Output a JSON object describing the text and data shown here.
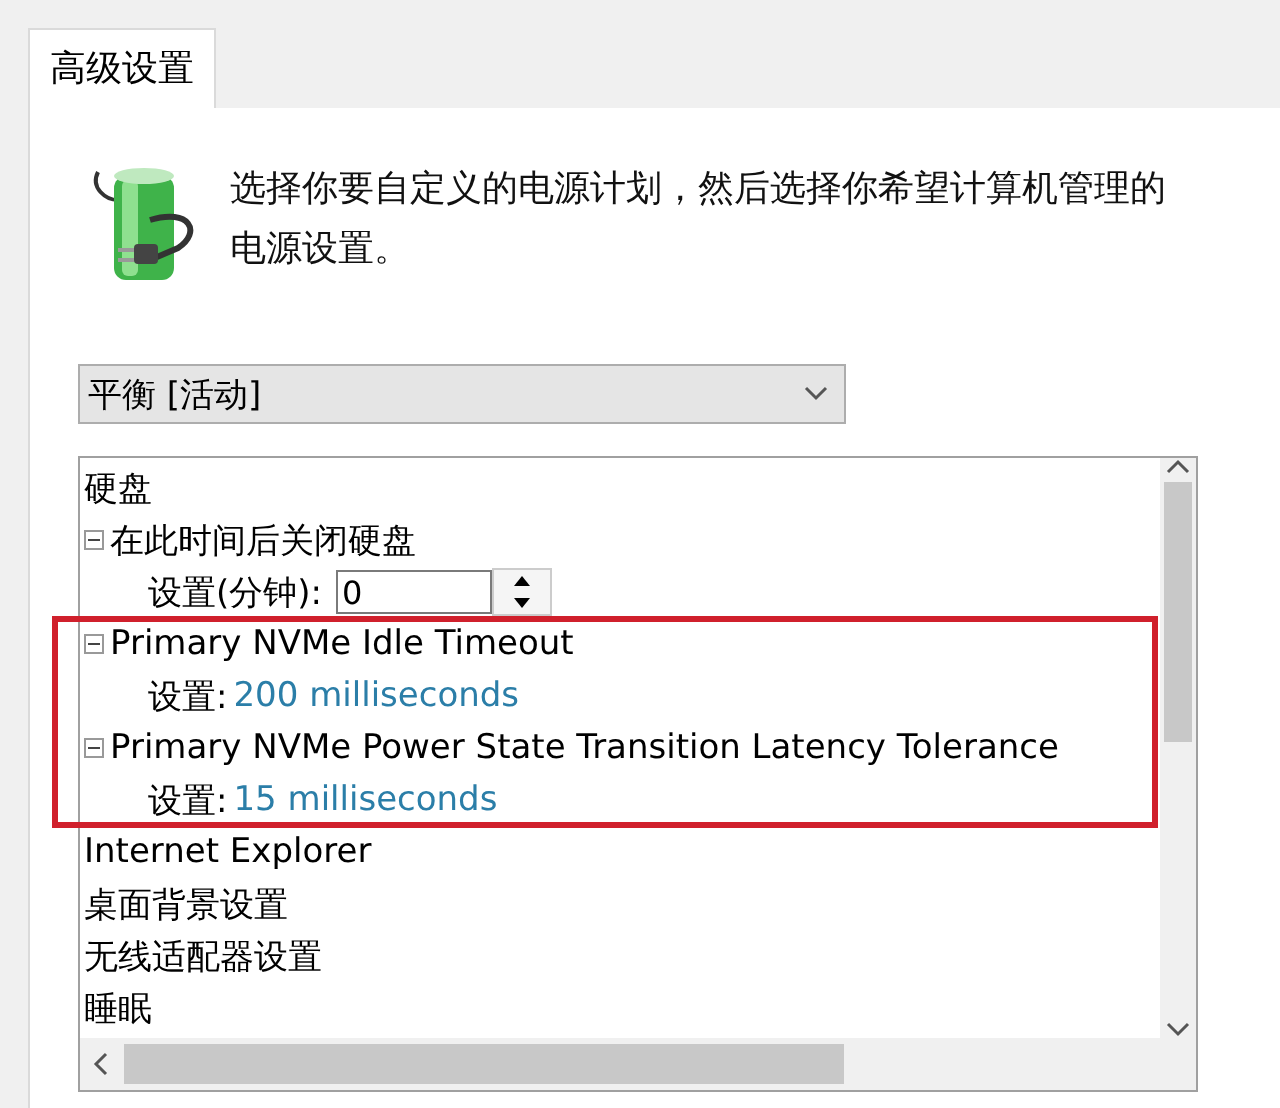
{
  "tabs": [
    {
      "label": "高级设置",
      "selected": true
    }
  ],
  "description": "选择你要自定义的电源计划，然后选择你希望计算机管理的电源设置。",
  "plan_select": {
    "value": "平衡 [活动]"
  },
  "tree": [
    {
      "label": "硬盘",
      "children": [
        {
          "label": "在此时间后关闭硬盘",
          "expanded": true,
          "children": [
            {
              "kind": "spin",
              "label": "设置(分钟):",
              "value": "0"
            }
          ]
        },
        {
          "label": "Primary NVMe Idle Timeout",
          "expanded": true,
          "children": [
            {
              "kind": "value",
              "label": "设置:",
              "value": "200 milliseconds"
            }
          ]
        },
        {
          "label": "Primary NVMe Power State Transition Latency Tolerance",
          "expanded": true,
          "children": [
            {
              "kind": "value",
              "label": "设置:",
              "value": "15 milliseconds"
            }
          ]
        }
      ]
    },
    {
      "label": "Internet Explorer"
    },
    {
      "label": "桌面背景设置"
    },
    {
      "label": "无线适配器设置"
    },
    {
      "label": "睡眠"
    }
  ],
  "annotation": {
    "color": "#d0202c"
  }
}
